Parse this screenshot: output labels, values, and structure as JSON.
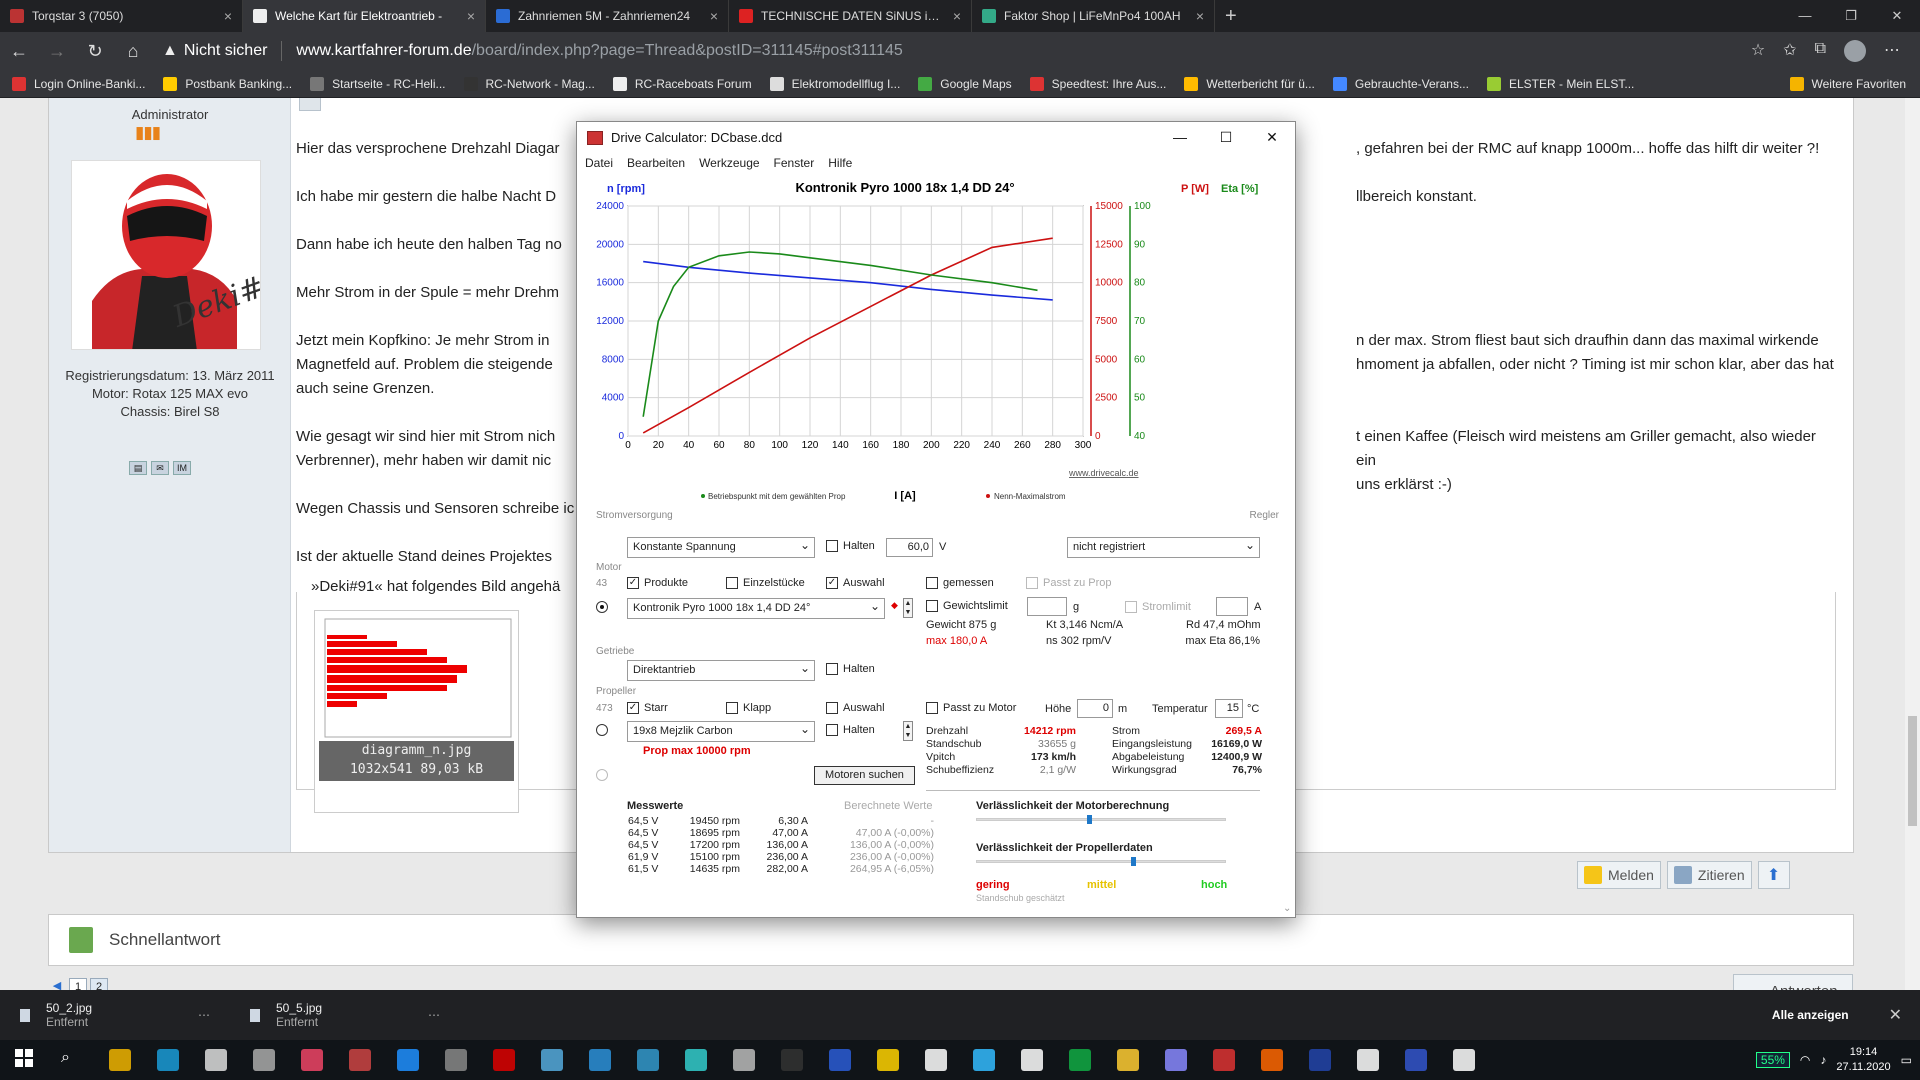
{
  "browser": {
    "tabs": [
      {
        "label": "Torqstar 3 (7050)",
        "color": "#b33"
      },
      {
        "label": "Welche Kart für Elektroantrieb - ",
        "color": "#eee",
        "active": true
      },
      {
        "label": "Zahnriemen 5M - Zahnriemen24",
        "color": "#2b6cd4"
      },
      {
        "label": "TECHNISCHE DATEN SiNUS iON",
        "color": "#d22"
      },
      {
        "label": "Faktor Shop | LiFeMnPo4 100AH",
        "color": "#3a8"
      }
    ],
    "new_tab": "+",
    "close": "×",
    "address": {
      "insecure": "Nicht sicher",
      "host": "www.kartfahrer-forum.de",
      "path": "/board/index.php?page=Thread&postID=311145#post311145"
    },
    "bookmarks": [
      {
        "label": "Login Online-Banki...",
        "color": "#d33"
      },
      {
        "label": "Postbank Banking...",
        "color": "#fc0"
      },
      {
        "label": "Startseite - RC-Heli...",
        "color": "#777"
      },
      {
        "label": "RC-Network - Mag...",
        "color": "#333"
      },
      {
        "label": "RC-Raceboats Forum",
        "color": "#eee"
      },
      {
        "label": "Elektromodellflug I...",
        "color": "#ddd"
      },
      {
        "label": "Google Maps",
        "color": "#4a4"
      },
      {
        "label": "Speedtest: Ihre Aus...",
        "color": "#d33"
      },
      {
        "label": "Wetterbericht für ü...",
        "color": "#fb0"
      },
      {
        "label": "Gebrauchte-Verans...",
        "color": "#48f"
      },
      {
        "label": "ELSTER - Mein ELST...",
        "color": "#9c3"
      }
    ],
    "bookmarks_more": "Weitere Favoriten"
  },
  "post": {
    "rank": "Administrator",
    "user_info": [
      "Registrierungsdatum: 13. März 2011",
      "Motor: Rotax 125 MAX evo",
      "Chassis: Birel S8"
    ],
    "avatar_text": "Deki#",
    "paragraphs": [
      "Hier das versprochene Drehzahl Diagar",
      "Ich habe mir gestern die halbe Nacht D",
      "Dann habe ich heute den halben Tag no",
      "Mehr Strom in der Spule = mehr Drehm",
      "Jetzt mein Kopfkino: Je mehr Strom in",
      "Wie gesagt wir sind hier mit Strom nich",
      "Wegen Chassis und Sensoren schreibe ic",
      "Ist der aktuelle Stand deines Projektes"
    ],
    "right_fragments": [
      ", gefahren bei der RMC auf knapp 1000m... hoffe das hilft dir weiter ?!",
      "llbereich konstant.",
      "n der max. Strom fliest baut sich draufhin dann das maximal wirkende",
      "hmoment ja abfallen, oder nicht ? Timing ist mir schon klar, aber das hat",
      "t einen Kaffee (Fleisch wird meistens am Griller gemacht, also wieder ein",
      "uns erklärst :-)"
    ],
    "left_wrap": [
      "Magnetfeld auf. Problem die steigende",
      "auch seine Grenzen.",
      "Verbrenner), mehr haben wir damit nic"
    ],
    "attachment_legend": "»Deki#91« hat folgendes Bild angehä",
    "thumb_caption": [
      "diagramm_n.jpg",
      "1032x541 89,03 kB"
    ],
    "buttons": {
      "report": "Melden",
      "quote": "Zitieren"
    },
    "quick_reply": "Schnellantwort",
    "pages": [
      "1",
      "2"
    ],
    "reply": "Antworten"
  },
  "dialog": {
    "title": "Drive Calculator: DCbase.dcd",
    "menu": [
      "Datei",
      "Bearbeiten",
      "Werkzeuge",
      "Fenster",
      "Hilfe"
    ],
    "chart": {
      "title": "Kontronik Pyro 1000 18x 1,4 DD 24°",
      "ylabel_left": "n [rpm]",
      "ylabel_p": "P [W]",
      "ylabel_eta": "Eta [%]",
      "xlabel": "I [A]",
      "legend_green": "Betriebspunkt mit dem gewählten Prop",
      "legend_red": "Nenn-Maximalstrom",
      "watermark": "www.drivecalc.de"
    },
    "chart_data": {
      "type": "line",
      "x_range": [
        0,
        300
      ],
      "x_ticks": [
        "0",
        "20",
        "40",
        "60",
        "80",
        "100",
        "120",
        "140",
        "160",
        "180",
        "200",
        "220",
        "240",
        "260",
        "280",
        "300"
      ],
      "y_left_ticks": [
        "0",
        "4000",
        "8000",
        "12000",
        "16000",
        "20000",
        "24000"
      ],
      "y_p_ticks": [
        "0",
        "2500",
        "5000",
        "7500",
        "10000",
        "12500",
        "15000"
      ],
      "y_eta_ticks": [
        "40",
        "50",
        "60",
        "70",
        "80",
        "90",
        "100"
      ],
      "series": [
        {
          "name": "n [rpm]",
          "axis": "left",
          "color": "#1a2adc",
          "x": [
            10,
            40,
            80,
            120,
            160,
            200,
            240,
            280
          ],
          "y": [
            18200,
            17600,
            17000,
            16500,
            16000,
            15300,
            14700,
            14200
          ]
        },
        {
          "name": "P [W]",
          "axis": "p",
          "color": "#c11",
          "x": [
            10,
            40,
            80,
            120,
            160,
            200,
            240,
            280
          ],
          "y": [
            200,
            1850,
            4150,
            6400,
            8450,
            10500,
            12300,
            12900
          ]
        },
        {
          "name": "Eta [%]",
          "axis": "eta",
          "color": "#1a8a1a",
          "x": [
            10,
            20,
            30,
            40,
            60,
            80,
            100,
            120,
            160,
            200,
            240,
            270
          ],
          "y": [
            45,
            70,
            79,
            84,
            87,
            88,
            87.5,
            86.5,
            84.5,
            82,
            80,
            78
          ]
        }
      ]
    },
    "power_supply": {
      "label": "Stromversorgung",
      "value": "Konstante Spannung",
      "halten": "Halten",
      "voltage": "60,0",
      "unit": "V",
      "regler": "Regler",
      "regler_value": "nicht registriert"
    },
    "motor": {
      "label": "Motor",
      "count": "43",
      "produkte": "Produkte",
      "einzelstuecke": "Einzelstücke",
      "auswahl": "Auswahl",
      "gemessen": "gemessen",
      "passt_zu_prop": "Passt zu Prop",
      "name": "Kontronik Pyro 1000 18x 1,4 DD 24°",
      "gewichtslimit": "Gewichtslimit",
      "g": "g",
      "stromlimit": "Stromlimit",
      "a": "A",
      "gewicht": "Gewicht 875 g",
      "kt": "Kt 3,146 Ncm/A",
      "rd": "Rd 47,4 mOhm",
      "max": "max 180,0 A",
      "ns": "ns 302 rpm/V",
      "max_eta": "max Eta 86,1%"
    },
    "gear": {
      "label": "Getriebe",
      "value": "Direktantrieb",
      "halten": "Halten"
    },
    "prop": {
      "label": "Propeller",
      "count": "473",
      "starr": "Starr",
      "klapp": "Klapp",
      "auswahl": "Auswahl",
      "passt_zu_motor": "Passt zu Motor",
      "hoehe": "Höhe",
      "hoehe_val": "0",
      "hoehe_unit": "m",
      "temp": "Temperatur",
      "temp_val": "15",
      "temp_unit": "°C",
      "name": "19x8 Mejzlik Carbon",
      "halten": "Halten",
      "warn": "Prop max 10000 rpm",
      "search": "Motoren suchen"
    },
    "results": [
      {
        "k": "Drehzahl",
        "v": "14212 rpm",
        "red": true
      },
      {
        "k": "Standschub",
        "v": "33655 g",
        "grey": true
      },
      {
        "k": "Vpitch",
        "v": "173 km/h"
      },
      {
        "k": "Schubeffizienz",
        "v": "2,1 g/W",
        "grey": true
      }
    ],
    "results2": [
      {
        "k": "Strom",
        "v": "269,5 A",
        "red": true
      },
      {
        "k": "Eingangsleistung",
        "v": "16169,0 W"
      },
      {
        "k": "Abgabeleistung",
        "v": "12400,9 W"
      },
      {
        "k": "Wirkungsgrad",
        "v": "76,7%"
      }
    ],
    "measured": {
      "title": "Messwerte",
      "calc_title": "Berechnete Werte",
      "rows": [
        [
          "64,5 V",
          "19450 rpm",
          "6,30 A",
          "-"
        ],
        [
          "64,5 V",
          "18695 rpm",
          "47,00 A",
          "47,00 A (-0,00%)"
        ],
        [
          "64,5 V",
          "17200 rpm",
          "136,00 A",
          "136,00 A (-0,00%)"
        ],
        [
          "61,9 V",
          "15100 rpm",
          "236,00 A",
          "236,00 A (-0,00%)"
        ],
        [
          "61,5 V",
          "14635 rpm",
          "282,00 A",
          "264,95 A (-6,05%)"
        ]
      ]
    },
    "reliability": {
      "motor": "Verlässlichkeit der Motorberechnung",
      "prop": "Verlässlichkeit der Propellerdaten",
      "low": "gering",
      "mid": "mittel",
      "high": "hoch",
      "note": "Standschub geschätzt",
      "motor_level": 0.45,
      "prop_level": 0.63
    }
  },
  "downloads": [
    {
      "name": "50_2.jpg",
      "status": "Entfernt"
    },
    {
      "name": "50_5.jpg",
      "status": "Entfernt"
    }
  ],
  "downloads_show_all": "Alle anzeigen",
  "taskbar": {
    "battery": "55%",
    "time": "19:14",
    "date": "27.11.2020"
  }
}
